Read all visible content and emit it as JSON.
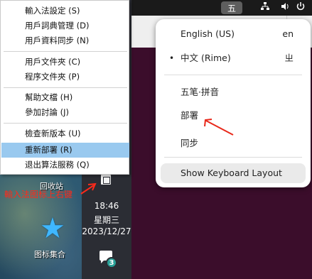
{
  "context_menu": {
    "items": [
      {
        "label": "輸入法設定 (S)"
      },
      {
        "label": "用戶詞典管理 (D)"
      },
      {
        "label": "用戶資料同步 (N)"
      },
      {
        "label": "用戶文件夾 (C)"
      },
      {
        "label": "程序文件夾 (P)"
      },
      {
        "label": "幫助文檔 (H)"
      },
      {
        "label": "參加討論 (J)"
      },
      {
        "label": "檢查新版本 (U)"
      },
      {
        "label": "重新部署 (R)",
        "highlighted": true
      },
      {
        "label": "退出算法服務 (Q)"
      }
    ]
  },
  "desktop": {
    "recycle_bin_label": "回收站",
    "annotation_text": "輸入法图标上右键",
    "collection_label": "图标集合"
  },
  "taskbar": {
    "time": "18:46",
    "weekday": "星期三",
    "date": "2023/12/27",
    "notification_count": "3"
  },
  "top_panel": {
    "input_badge": "五"
  },
  "input_popup": {
    "sources": [
      {
        "label": "English (US)",
        "code": "en",
        "active": false
      },
      {
        "label": "中文 (Rime)",
        "code": "ㄓ",
        "active": true
      }
    ],
    "schemas": [
      {
        "label": "五笔·拼音"
      },
      {
        "label": "部署"
      },
      {
        "label": "同步"
      }
    ],
    "show_keyboard_layout": "Show Keyboard Layout"
  },
  "colors": {
    "menu_highlight": "#99c9ef",
    "annotation_red": "#ff2a1a",
    "desktop_bg": "#3b0d2b"
  }
}
